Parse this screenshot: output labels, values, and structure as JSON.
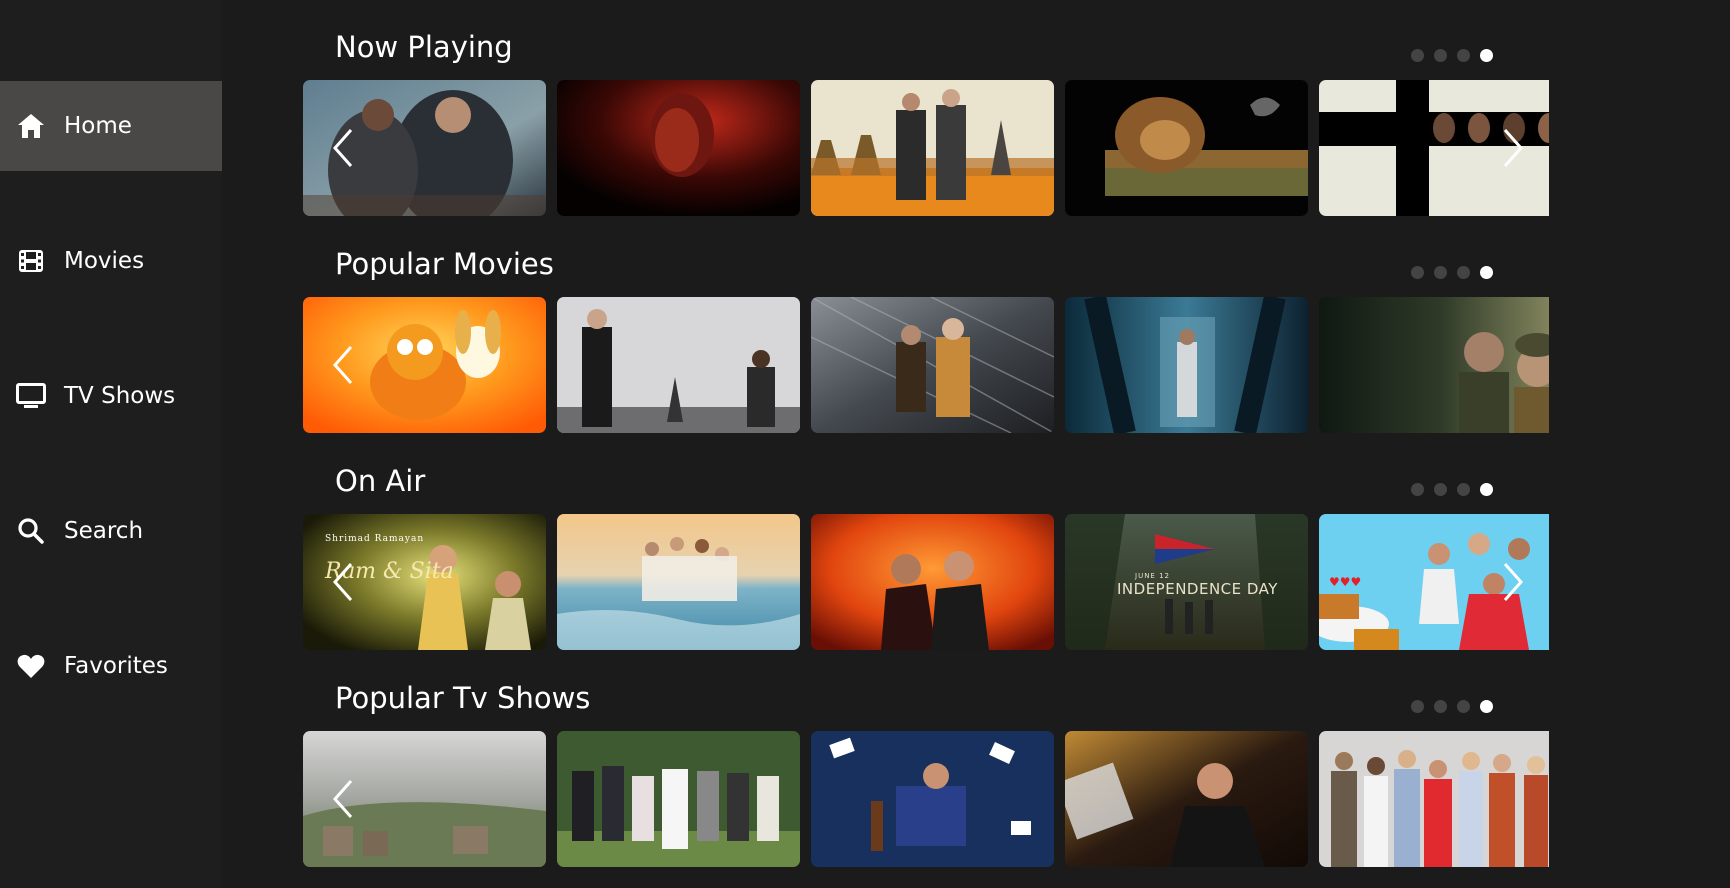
{
  "sidebar": {
    "items": [
      {
        "label": "Home",
        "icon": "home-icon",
        "active": true
      },
      {
        "label": "Movies",
        "icon": "film-icon",
        "active": false
      },
      {
        "label": "TV Shows",
        "icon": "tv-icon",
        "active": false
      },
      {
        "label": "Search",
        "icon": "search-icon",
        "active": false
      },
      {
        "label": "Favorites",
        "icon": "heart-icon",
        "active": false
      }
    ]
  },
  "sections": [
    {
      "title": "Now Playing",
      "page_count": 4,
      "active_page": 4
    },
    {
      "title": "Popular Movies",
      "page_count": 4,
      "active_page": 4
    },
    {
      "title": "On Air",
      "page_count": 4,
      "active_page": 4
    },
    {
      "title": "Popular Tv Shows",
      "page_count": 4,
      "active_page": 4
    }
  ],
  "posters": {
    "ramayan_line1": "Shrimad Ramayan",
    "ramayan_line2": "Ram & Sita",
    "independence_line1": "JUNE 12",
    "independence_line2": "INDEPENDENCE DAY"
  },
  "colors": {
    "accent_active_nav": "#4a4847",
    "background": "#1b1b1b"
  }
}
